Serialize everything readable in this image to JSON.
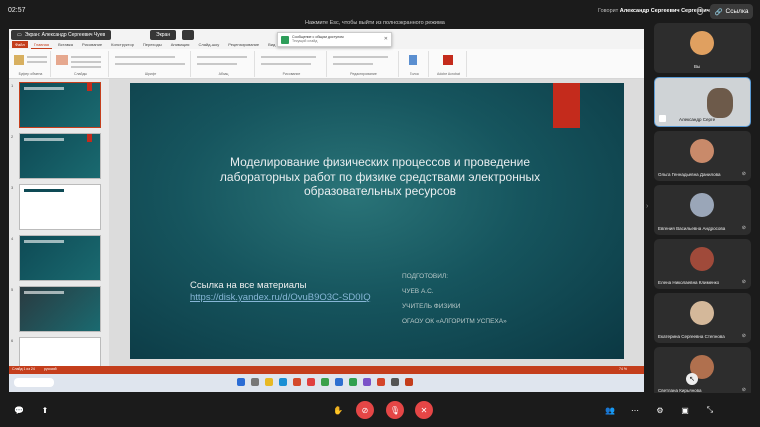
{
  "topbar": {
    "time": "02:57",
    "esc_hint": "Нажмите Esc, чтобы выйти из полноэкранного режима",
    "speaker_prefix": "Говорит",
    "speaker_name": "Александр Сергеевич Сергеевич Ч.",
    "link_button": "Ссылка"
  },
  "share": {
    "label": "Экран: Александр Сергеевич Чуев",
    "screen_label": "Экран"
  },
  "ppt": {
    "tabs": [
      "Файл",
      "Главная",
      "Вставка",
      "Рисование",
      "Конструктор",
      "Переходы",
      "Анимация",
      "Слайд-шоу",
      "Рецензирование",
      "Вид",
      "Справка"
    ],
    "toast": "Сообщение с общим доступом",
    "toast_sub": "Текущий слайд",
    "groups": [
      "Буфер обмена",
      "Слайды",
      "Шрифт",
      "Абзац",
      "Рисование",
      "Редактирование",
      "Голос",
      "Adobe Acrobat"
    ],
    "status_left": "Слайд 1 из 24",
    "status_lang": "русский",
    "status_zoom": "74 %"
  },
  "slide": {
    "title": "Моделирование физических процессов и проведение лабораторных работ по физике средствами электронных образовательных ресурсов",
    "link_caption": "Ссылка на все материалы",
    "link_url": "https://disk.yandex.ru/d/OvuB9O3C-SD0IQ",
    "prepared_lines": [
      "ПОДГОТОВИЛ:",
      "ЧУЕВ А.С.",
      "УЧИТЕЛЬ ФИЗИКИ",
      "ОГАОУ ОК «АЛГОРИТМ УСПЕХА»"
    ]
  },
  "participants": [
    {
      "name": "Вы",
      "avatar_color": "#e0a060"
    },
    {
      "name": "Александр Серге",
      "avatar_color": "#6d5a4a"
    },
    {
      "name": "Ольга Геннадьевна Данилова",
      "avatar_color": "#c98a6a"
    },
    {
      "name": "Евгения Васильевна Андросова",
      "avatar_color": "#9aa6b8"
    },
    {
      "name": "Елена Николаевна Клименко",
      "avatar_color": "#a04a3a"
    },
    {
      "name": "Екатерина Сергеевна Степнова",
      "avatar_color": "#d4b89a"
    },
    {
      "name": "Светлана Кирьянова",
      "avatar_color": "#b0704e"
    }
  ],
  "icons": {
    "mic_off": "🎤",
    "camera_off": "📷"
  }
}
